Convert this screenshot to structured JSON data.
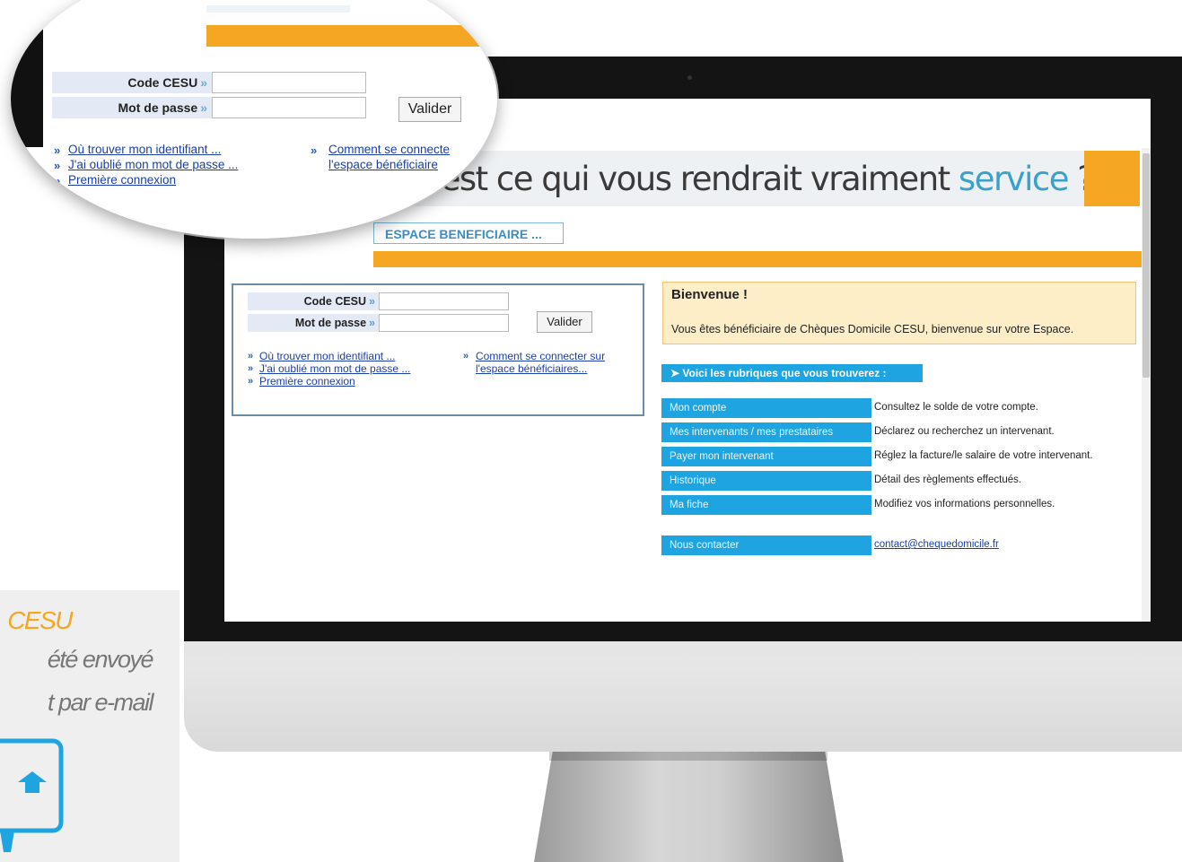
{
  "promo": {
    "line1": "CESU",
    "line2": "été envoyé",
    "line3": "t par e-mail",
    "accent_color": "#f5a623",
    "icon": "computer-icon"
  },
  "hero": {
    "text_main": "u'est ce qui vous rendrait vraiment ",
    "text_accent": "service",
    "text_end": " ?"
  },
  "tab": {
    "label": "ESPACE BENEFICIAIRE ..."
  },
  "login": {
    "code_label": "Code CESU",
    "password_label": "Mot de passe",
    "arrow": "»",
    "submit_label": "Valider",
    "links": [
      "Où trouver mon identifiant ...",
      "J'ai oublié mon mot de passe ...",
      "Première connexion"
    ],
    "connect_link_line1": "Comment se connecter sur",
    "connect_link_line2": "l'espace bénéficiaires..."
  },
  "magnifier": {
    "code_label": "Code CESU",
    "password_label": "Mot de passe",
    "arrow": "»",
    "submit_label": "Valider",
    "links": [
      "Où trouver mon identifiant ...",
      "J'ai oublié mon mot de passe ...",
      "Première connexion"
    ],
    "connect_link_line1": "Comment se connecte",
    "connect_link_line2": "l'espace bénéficiaire"
  },
  "welcome": {
    "title": "Bienvenue !",
    "text": "Vous êtes bénéficiaire de Chèques Domicile CESU, bienvenue sur votre Espace."
  },
  "rubriques": {
    "header": "➤ Voici les rubriques que vous trouverez :",
    "items": [
      {
        "label": "Mon compte",
        "desc": "Consultez le solde de votre compte."
      },
      {
        "label": "Mes intervenants / mes prestataires",
        "desc": "Déclarez ou recherchez un intervenant."
      },
      {
        "label": "Payer mon intervenant",
        "desc": "Réglez la facture/le salaire de votre intervenant."
      },
      {
        "label": "Historique",
        "desc": "Détail des règlements effectués."
      },
      {
        "label": "Ma fiche",
        "desc": "Modifiez vos informations personnelles."
      }
    ],
    "contact_label": "Nous contacter",
    "contact_email": "contact@chequedomicile.fr"
  },
  "colors": {
    "orange": "#f5a623",
    "blue": "#1fa4e2",
    "link": "#1a3fa8"
  }
}
